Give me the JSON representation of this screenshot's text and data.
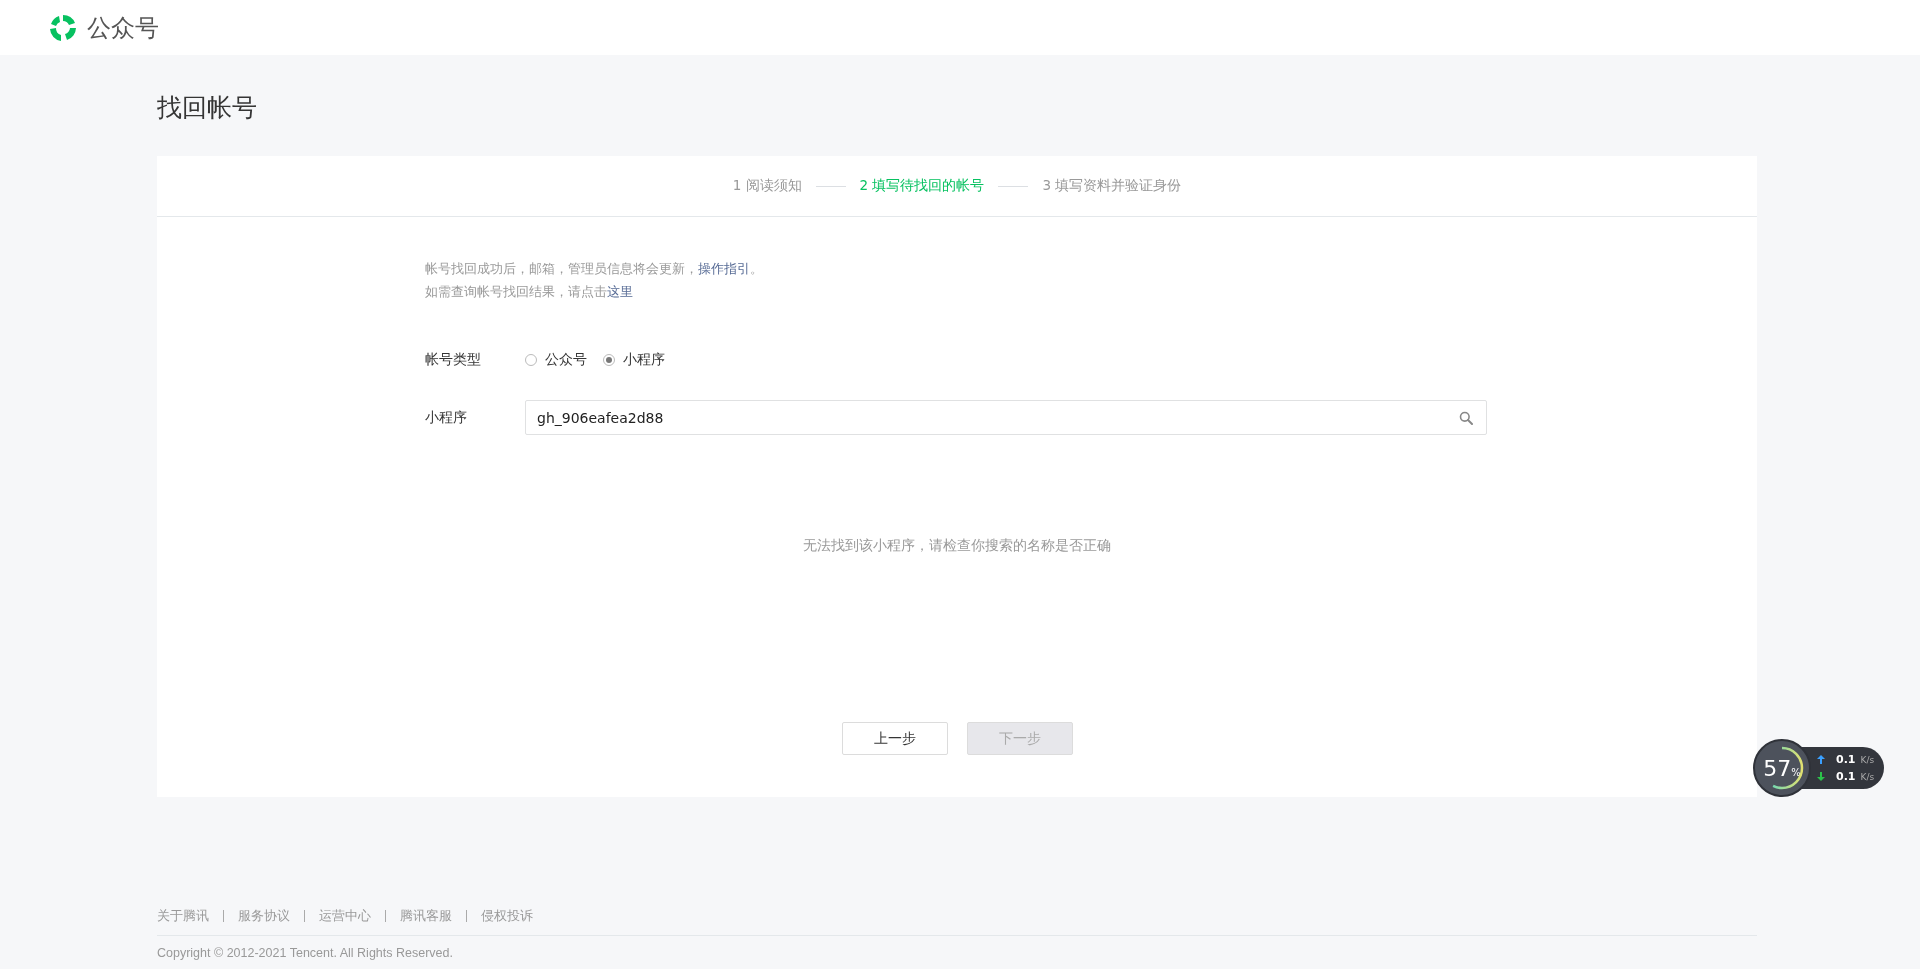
{
  "header": {
    "logo_text": "公众号"
  },
  "page_title": "找回帐号",
  "steps": [
    {
      "label": "1 阅读须知",
      "selected": false
    },
    {
      "label": "2 填写待找回的帐号",
      "selected": true
    },
    {
      "label": "3 填写资料并验证身份",
      "selected": false
    }
  ],
  "notes": [
    {
      "text": "帐号找回成功后，邮箱，管理员信息将会更新，",
      "link": "操作指引",
      "after": "。"
    },
    {
      "text": "如需查询帐号找回结果，请点击",
      "link": "这里"
    }
  ],
  "account_type": {
    "label": "帐号类型",
    "options": [
      {
        "label": "公众号",
        "selected": false
      },
      {
        "label": "小程序",
        "selected": true
      }
    ]
  },
  "search_field": {
    "label": "小程序",
    "value": "gh_906eafea2d88"
  },
  "message": "无法找到该小程序，请检查你搜索的名称是否正确",
  "buttons": [
    {
      "label": "上一步",
      "disabled": false
    },
    {
      "label": "下一步",
      "disabled": true
    }
  ],
  "footer": {
    "links": [
      "关于腾讯",
      "服务协议",
      "运营中心",
      "腾讯客服",
      "侵权投诉"
    ],
    "copyright": "Copyright © 2012-2021 Tencent. All Rights Reserved."
  },
  "speed_widget": {
    "percent": "57",
    "percent_sign": "%",
    "upload": "0.1",
    "upload_unit": "K/s",
    "download": "0.1",
    "download_unit": "K/s"
  }
}
